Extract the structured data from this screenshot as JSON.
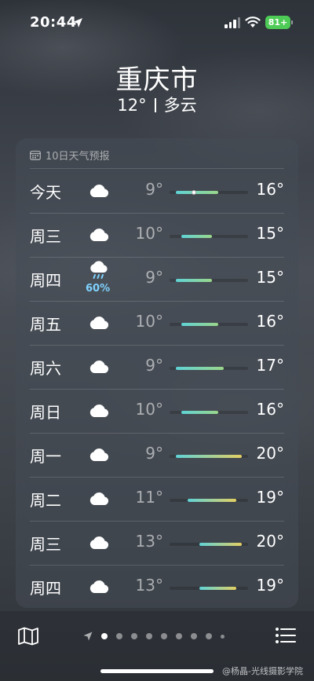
{
  "status_bar": {
    "time": "20:44",
    "battery": "81+",
    "battery_color": "#4ecb56",
    "icons": [
      "location-arrow-icon",
      "cellular-signal-icon",
      "wifi-icon",
      "battery-icon"
    ]
  },
  "location": {
    "city": "重庆市",
    "current_temp": "12°",
    "condition": "多云"
  },
  "forecast": {
    "header": "10日天气预报",
    "header_icon": "calendar-icon",
    "days": [
      {
        "day": "今天",
        "icon": "cloud-icon",
        "low": "9°",
        "high": "16°",
        "range_low": 9,
        "range_high": 16,
        "precip": "",
        "current_temp": 12
      },
      {
        "day": "周三",
        "icon": "cloud-icon",
        "low": "10°",
        "high": "15°",
        "range_low": 10,
        "range_high": 15,
        "precip": ""
      },
      {
        "day": "周四",
        "icon": "rain-cloud-icon",
        "low": "9°",
        "high": "15°",
        "range_low": 9,
        "range_high": 15,
        "precip": "60%"
      },
      {
        "day": "周五",
        "icon": "cloud-icon",
        "low": "10°",
        "high": "16°",
        "range_low": 10,
        "range_high": 16,
        "precip": ""
      },
      {
        "day": "周六",
        "icon": "cloud-icon",
        "low": "9°",
        "high": "17°",
        "range_low": 9,
        "range_high": 17,
        "precip": ""
      },
      {
        "day": "周日",
        "icon": "cloud-icon",
        "low": "10°",
        "high": "16°",
        "range_low": 10,
        "range_high": 16,
        "precip": ""
      },
      {
        "day": "周一",
        "icon": "cloud-icon",
        "low": "9°",
        "high": "20°",
        "range_low": 9,
        "range_high": 20,
        "precip": ""
      },
      {
        "day": "周二",
        "icon": "cloud-icon",
        "low": "11°",
        "high": "19°",
        "range_low": 11,
        "range_high": 19,
        "precip": ""
      },
      {
        "day": "周三",
        "icon": "cloud-icon",
        "low": "13°",
        "high": "20°",
        "range_low": 13,
        "range_high": 20,
        "precip": ""
      },
      {
        "day": "周四",
        "icon": "cloud-icon",
        "low": "13°",
        "high": "19°",
        "range_low": 13,
        "range_high": 19,
        "precip": ""
      }
    ],
    "scale_min": 8,
    "scale_max": 21,
    "colors": {
      "cool": "#5fd3d6",
      "mild": "#9ad68a",
      "warm": "#e3cf62",
      "precip": "#7fd2ff"
    }
  },
  "bottom_bar": {
    "map_icon": "map-icon",
    "list_icon": "list-icon",
    "page_count": 9,
    "active_page": 0,
    "watermark": "@杨晶-光线摄影学院"
  }
}
